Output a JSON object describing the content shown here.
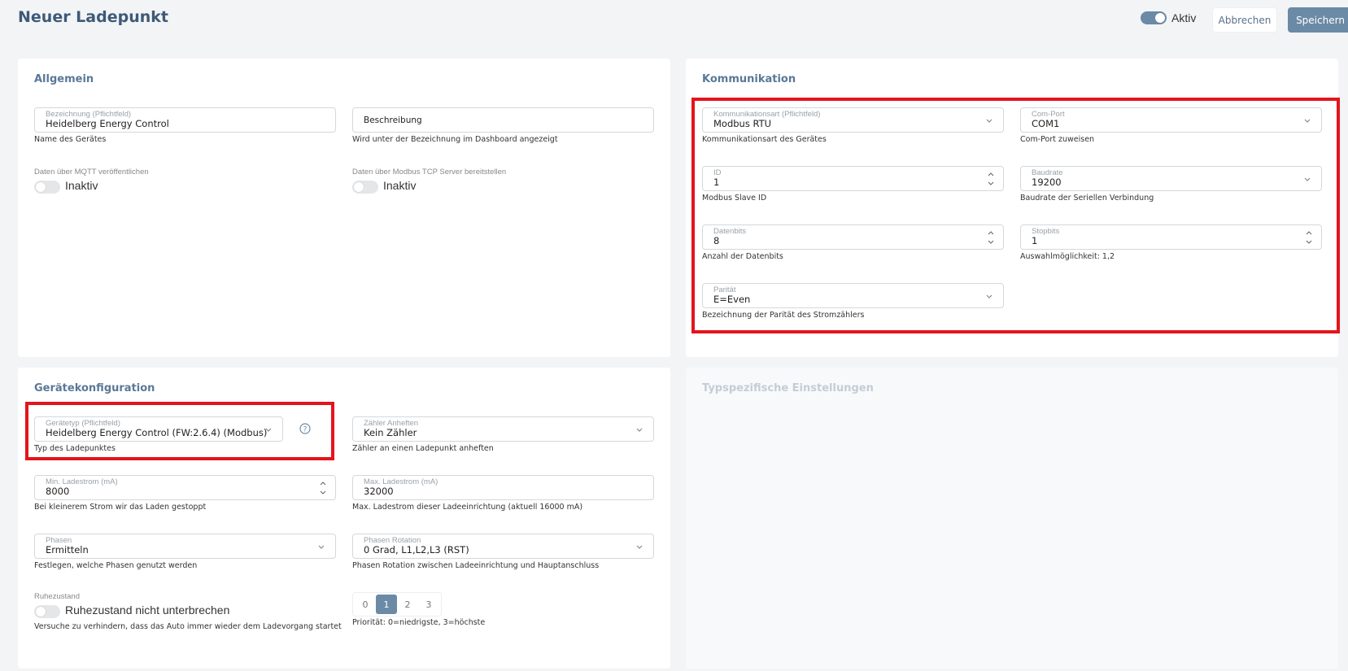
{
  "header": {
    "title": "Neuer Ladepunkt",
    "aktiv_label": "Aktiv",
    "cancel_label": "Abbrechen",
    "save_label": "Speichern"
  },
  "colors": {
    "accent": "#6b8aa6",
    "title": "#3d5a78",
    "highlight": "#e3141c"
  },
  "allgemein": {
    "title": "Allgemein",
    "bezeichnung": {
      "label": "Bezeichnung (Pflichtfeld)",
      "value": "Heidelberg Energy Control",
      "hint": "Name des Gerätes"
    },
    "beschreibung": {
      "placeholder": "Beschreibung",
      "hint": "Wird unter der Bezeichnung im Dashboard angezeigt"
    },
    "mqtt": {
      "label": "Daten über MQTT veröffentlichen",
      "state": "Inaktiv"
    },
    "modbus_tcp": {
      "label": "Daten über Modbus TCP Server bereitstellen",
      "state": "Inaktiv"
    }
  },
  "kommunikation": {
    "title": "Kommunikation",
    "art": {
      "label": "Kommunikationsart (Pflichtfeld)",
      "value": "Modbus RTU",
      "hint": "Kommunikationsart des Gerätes"
    },
    "comport": {
      "label": "Com-Port",
      "value": "COM1",
      "hint": "Com-Port zuweisen"
    },
    "id": {
      "label": "ID",
      "value": "1",
      "hint": "Modbus Slave ID"
    },
    "baudrate": {
      "label": "Baudrate",
      "value": "19200",
      "hint": "Baudrate der Seriellen Verbindung"
    },
    "datenbits": {
      "label": "Datenbits",
      "value": "8",
      "hint": "Anzahl der Datenbits"
    },
    "stopbits": {
      "label": "Stopbits",
      "value": "1",
      "hint": "Auswahlmöglichkeit: 1,2"
    },
    "paritaet": {
      "label": "Parität",
      "value": "E=Even",
      "hint": "Bezeichnung der Parität des Stromzählers"
    }
  },
  "geraet": {
    "title": "Gerätekonfiguration",
    "typ": {
      "label": "Gerätetyp (Pflichtfeld)",
      "value": "Heidelberg Energy Control (FW:2.6.4) (Modbus)",
      "hint": "Typ des Ladepunktes"
    },
    "zaehler": {
      "label": "Zähler Anheften",
      "value": "Kein Zähler",
      "hint": "Zähler an einen Ladepunkt anheften"
    },
    "min": {
      "label": "Min. Ladestrom (mA)",
      "value": "8000",
      "hint": "Bei kleinerem Strom wir das Laden gestoppt"
    },
    "max": {
      "label": "Max. Ladestrom (mA)",
      "value": "32000",
      "hint": "Max. Ladestrom dieser Ladeeinrichtung (aktuell 16000 mA)"
    },
    "phasen": {
      "label": "Phasen",
      "value": "Ermitteln",
      "hint": "Festlegen, welche Phasen genutzt werden"
    },
    "rotation": {
      "label": "Phasen Rotation",
      "value": "0 Grad, L1,L2,L3 (RST)",
      "hint": "Phasen Rotation zwischen Ladeeinrichtung und Hauptanschluss"
    },
    "ruhe": {
      "label": "Ruhezustand",
      "state": "Ruhezustand nicht unterbrechen",
      "hint": "Versuche zu verhindern, dass das Auto immer wieder dem Ladevorgang startet"
    },
    "prioritaet": {
      "options": [
        "0",
        "1",
        "2",
        "3"
      ],
      "selected": "1",
      "hint": "Priorität: 0=niedrigste, 3=höchste"
    }
  },
  "typspezifisch": {
    "title": "Typspezifische Einstellungen"
  }
}
